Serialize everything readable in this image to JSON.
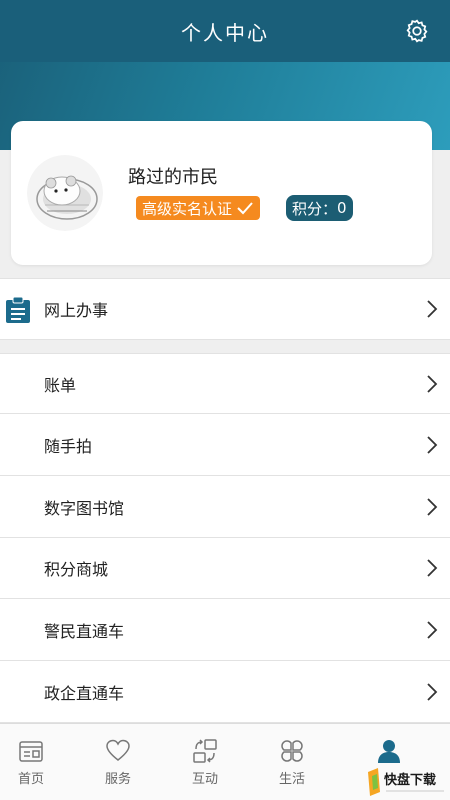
{
  "header": {
    "title": "个人中心"
  },
  "profile": {
    "username": "路过的市民",
    "cert_badge": "高级实名认证",
    "points_label": "积分：",
    "points_value": "0"
  },
  "menu": {
    "online_affairs": "网上办事",
    "items": [
      "账单",
      "随手拍",
      "数字图书馆",
      "积分商城",
      "警民直通车",
      "政企直通车"
    ]
  },
  "tabbar": {
    "items": [
      {
        "label": "首页",
        "icon": "home-card-icon"
      },
      {
        "label": "服务",
        "icon": "heart-icon"
      },
      {
        "label": "互动",
        "icon": "interaction-icon"
      },
      {
        "label": "生活",
        "icon": "grid-petals-icon"
      },
      {
        "label": "",
        "icon": "person-icon",
        "active": true
      }
    ]
  },
  "watermark": {
    "text": "快盘下载"
  },
  "colors": {
    "header": "#1a5f7a",
    "accent_orange": "#f58a1f",
    "points_badge": "#1c5d73",
    "icon_blue": "#1c6b8c"
  }
}
